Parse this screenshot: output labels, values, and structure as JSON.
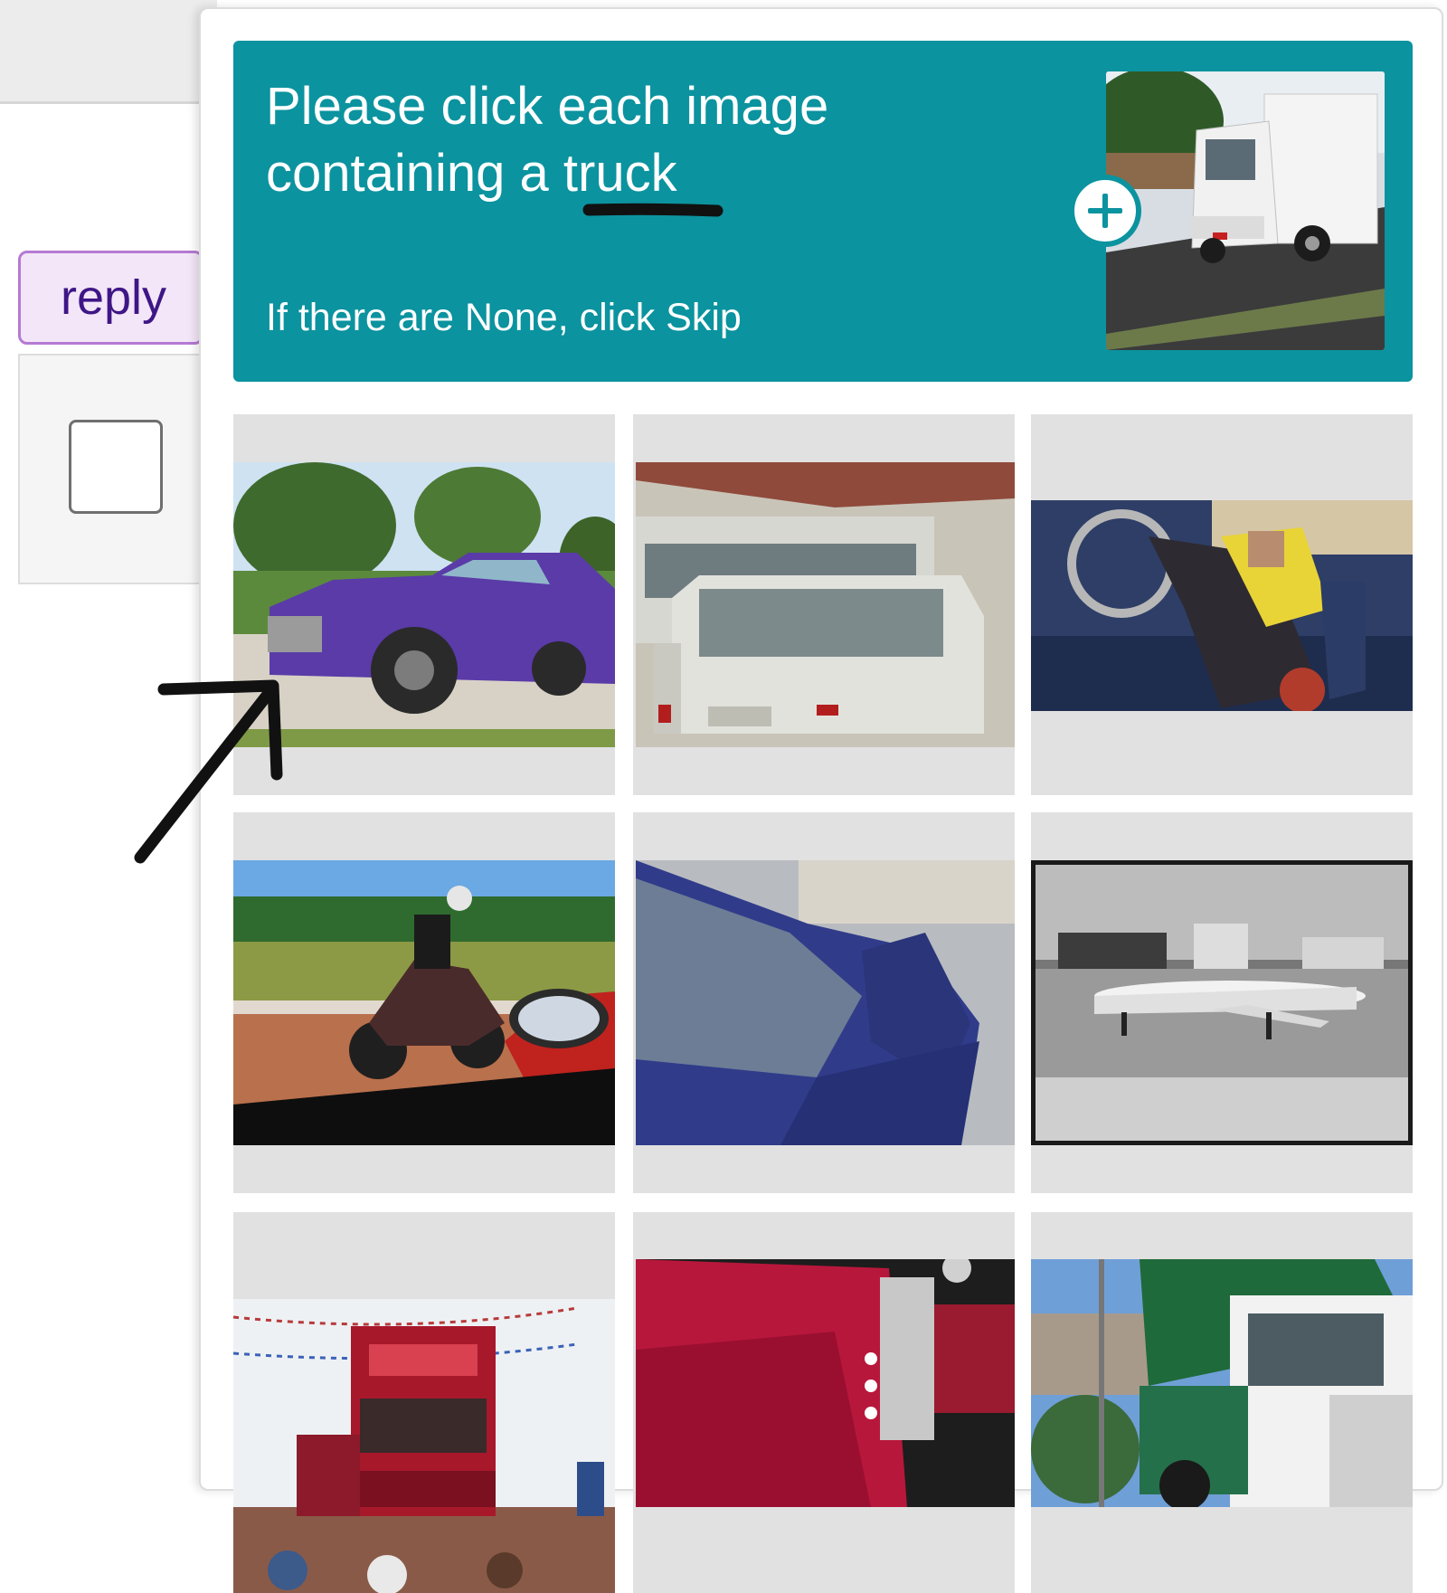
{
  "page": {
    "reply_label": "reply"
  },
  "captcha": {
    "prompt_line1": "Please click each image",
    "prompt_line2_prefix": "containing a ",
    "target_word": "truck",
    "skip_hint": "If there are None, click Skip",
    "example_image": "white box truck",
    "tiles": [
      {
        "content": "purple pickup car"
      },
      {
        "content": "white van and bus"
      },
      {
        "content": "motorcycle wheelie rider"
      },
      {
        "content": "sport motorcycle on road"
      },
      {
        "content": "blue car hood close-up"
      },
      {
        "content": "airplane on runway (black and white)"
      },
      {
        "content": "red truck cab at festival"
      },
      {
        "content": "red truck hood close-up"
      },
      {
        "content": "green and white garbage truck"
      }
    ]
  },
  "colors": {
    "banner": "#0b939f",
    "reply_text": "#3e1686",
    "reply_border": "#b57ad3",
    "annotation": "#111111"
  }
}
